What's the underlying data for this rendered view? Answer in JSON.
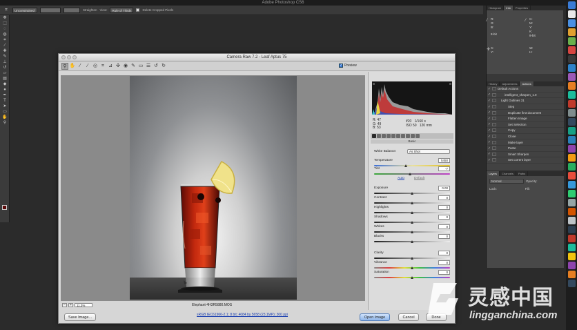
{
  "app": {
    "title": "Adobe Photoshop CS6"
  },
  "options_bar": {
    "straighten_label": "Straighten",
    "view_label": "View:",
    "view_value": "Rule of Thirds",
    "delete_cropped_label": "Delete Cropped Pixels",
    "ratio_value": "Unconstrained"
  },
  "right_panels": {
    "top_tabs": [
      "Histogram",
      "Info",
      "Properties"
    ],
    "info_labels": [
      "R:",
      "G:",
      "B:",
      "8-bit",
      "C:",
      "M:",
      "Y:",
      "K:",
      "8-bit",
      "X:",
      "Y:",
      "W:",
      "H:"
    ],
    "mid_tabs": [
      "History",
      "Adjustments",
      "Actions"
    ],
    "actions": [
      "Default Actions",
      "intelligent_sharpen_1.0",
      "Light Outlines 31",
      "Step",
      "Duplicate first document",
      "Flatten Image",
      "Set Selection",
      "Copy",
      "Close",
      "Make layer",
      "Paste",
      "Smart Sharpen",
      "Set current layer"
    ],
    "layer_tabs": [
      "Layers",
      "Channels",
      "Paths"
    ],
    "blend_mode": "Normal",
    "opacity_label": "Opacity:",
    "lock_label": "Lock:",
    "fill_label": "Fill:"
  },
  "dialog": {
    "title": "Camera Raw 7.2  -  Leaf Aptus 75",
    "preview_label": "Preview",
    "zoom_value": "11.3%",
    "filename": "Elephant-4H3R5880.MOS",
    "workflow_link": "sRGB IEC61966-2.1; 8 bit; 4084 by 5658 (23.1MP); 300 ppi",
    "buttons": {
      "save": "Save Image...",
      "open": "Open Image",
      "cancel": "Cancel",
      "done": "Done"
    },
    "readout": {
      "r_label": "R:",
      "r_value": "47",
      "g_label": "G:",
      "g_value": "49",
      "b_label": "B:",
      "b_value": "53",
      "aperture": "f/20",
      "shutter": "1/160 s",
      "iso": "ISO 50",
      "focal": "120 mm"
    },
    "section_title": "Basic",
    "white_balance_label": "White Balance:",
    "white_balance_value": "As Shot",
    "auto_label": "Auto",
    "default_label": "Default",
    "sliders": [
      {
        "label": "Temperature",
        "value": "5450",
        "pos": 0.42,
        "track": "temp"
      },
      {
        "label": "Tint",
        "value": "-7",
        "pos": 0.48,
        "track": "tint"
      },
      {
        "label": "Exposure",
        "value": "0.00",
        "pos": 0.5,
        "track": "gray"
      },
      {
        "label": "Contrast",
        "value": "0",
        "pos": 0.5,
        "track": "gray"
      },
      {
        "label": "Highlights",
        "value": "0",
        "pos": 0.5,
        "track": "gray"
      },
      {
        "label": "Shadows",
        "value": "0",
        "pos": 0.5,
        "track": "gray"
      },
      {
        "label": "Whites",
        "value": "0",
        "pos": 0.5,
        "track": "gray"
      },
      {
        "label": "Blacks",
        "value": "0",
        "pos": 0.5,
        "track": "gray"
      },
      {
        "label": "Clarity",
        "value": "0",
        "pos": 0.5,
        "track": "gray"
      },
      {
        "label": "Vibrance",
        "value": "0",
        "pos": 0.5,
        "track": "sat"
      },
      {
        "label": "Saturation",
        "value": "0",
        "pos": 0.5,
        "track": "sat"
      }
    ]
  },
  "watermark": {
    "chinese": "灵感中国",
    "english": "lingganchina.com"
  }
}
